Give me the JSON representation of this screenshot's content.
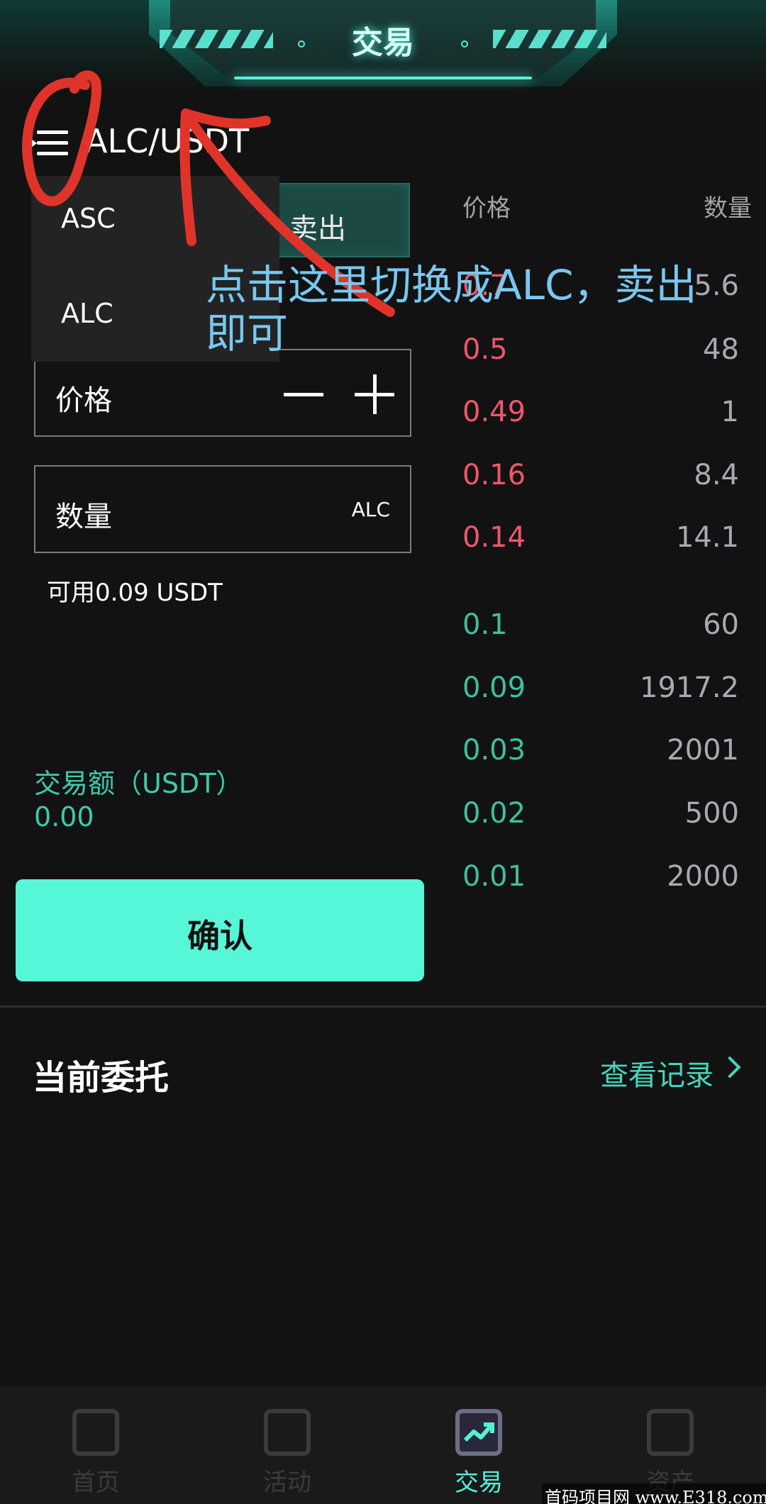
{
  "header": {
    "title": "交易"
  },
  "pair": {
    "label": "ALC/USDT"
  },
  "dropdown": {
    "items": [
      "ASC",
      "ALC"
    ]
  },
  "tab": {
    "sell_label": "卖出"
  },
  "form": {
    "price_label": "价格",
    "quantity_label": "数量",
    "quantity_unit": "ALC",
    "available": "可用0.09 USDT",
    "amount_label": "交易额（USDT）",
    "amount_value": "0.00",
    "confirm_label": "确认"
  },
  "order_book": {
    "price_header": "价格",
    "qty_header": "数量",
    "asks": [
      {
        "price": "0.7",
        "qty": "5.6"
      },
      {
        "price": "0.5",
        "qty": "48"
      },
      {
        "price": "0.49",
        "qty": "1"
      },
      {
        "price": "0.16",
        "qty": "8.4"
      },
      {
        "price": "0.14",
        "qty": "14.1"
      }
    ],
    "bids": [
      {
        "price": "0.1",
        "qty": "60"
      },
      {
        "price": "0.09",
        "qty": "1917.2"
      },
      {
        "price": "0.03",
        "qty": "2001"
      },
      {
        "price": "0.02",
        "qty": "500"
      },
      {
        "price": "0.01",
        "qty": "2000"
      }
    ]
  },
  "orders": {
    "title": "当前委托",
    "history_link": "查看记录"
  },
  "annotation": {
    "line1": "点击这里切换成ALC，卖出",
    "line2": "即可"
  },
  "bottom_nav": {
    "items": [
      "首页",
      "活动",
      "交易",
      "资产"
    ],
    "active_index": 2
  },
  "watermark": "首码项目网 www.E318.com",
  "colors": {
    "accent": "#56f7d9",
    "ask": "#f0566b",
    "bid": "#3fbf9f",
    "annotation": "#78c8f0",
    "scribble": "#e0342a"
  }
}
